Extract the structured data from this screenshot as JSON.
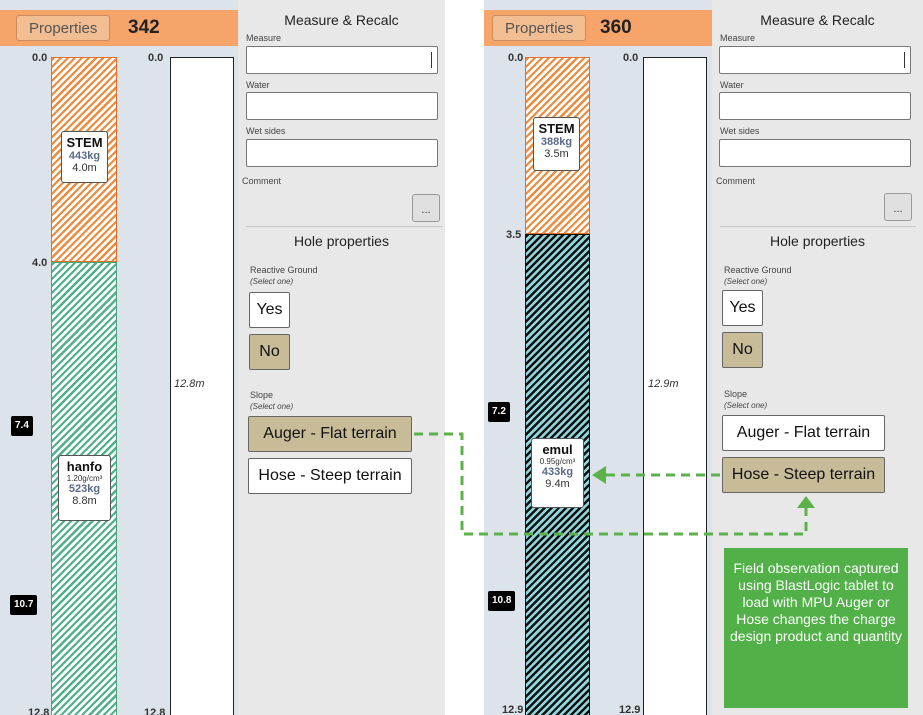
{
  "left": {
    "properties_label": "Properties",
    "hole_number": "342",
    "depth_top": "0.0",
    "depth_top_hole": "0.0",
    "depth_stem_bottom": "4.0",
    "tag_upper": "7.4",
    "tag_lower": "10.7",
    "depth_bottom": "12.8",
    "depth_bottom_hole": "12.8",
    "hole_length": "12.8m",
    "stem": {
      "name": "STEM",
      "kg": "443kg",
      "length": "4.0m"
    },
    "charge": {
      "name": "hanfo",
      "density": "1.20g/cm³",
      "kg": "523kg",
      "length": "8.8m"
    },
    "form": {
      "title": "Measure & Recalc",
      "measure_label": "Measure",
      "water_label": "Water",
      "wet_sides_label": "Wet sides",
      "comment_label": "Comment",
      "dots_label": "...",
      "hole_props_title": "Hole properties",
      "reactive_label": "Reactive Ground",
      "select_one": "(Select one)",
      "yes": "Yes",
      "no": "No",
      "slope_label": "Slope",
      "slope_select_one": "(Select one)",
      "auger": "Auger - Flat terrain",
      "hose": "Hose - Steep terrain"
    }
  },
  "right": {
    "properties_label": "Properties",
    "hole_number": "360",
    "depth_top": "0.0",
    "depth_top_hole": "0.0",
    "depth_stem_bottom": "3.5",
    "tag_upper": "7.2",
    "tag_lower": "10.8",
    "depth_bottom": "12.9",
    "depth_bottom_hole": "12.9",
    "hole_length": "12.9m",
    "stem": {
      "name": "STEM",
      "kg": "388kg",
      "length": "3.5m"
    },
    "charge": {
      "name": "emul",
      "density": "0.95g/cm³",
      "kg": "433kg",
      "length": "9.4m"
    },
    "form": {
      "title": "Measure & Recalc",
      "measure_label": "Measure",
      "water_label": "Water",
      "wet_sides_label": "Wet sides",
      "comment_label": "Comment",
      "dots_label": "...",
      "hole_props_title": "Hole properties",
      "reactive_label": "Reactive Ground",
      "select_one": "(Select one)",
      "yes": "Yes",
      "no": "No",
      "slope_label": "Slope",
      "slope_select_one": "(Select one)",
      "auger": "Auger - Flat terrain",
      "hose": "Hose - Steep terrain"
    }
  },
  "annotation": "Field observation captured using BlastLogic tablet to load with MPU Auger or Hose changes the charge design product and quantity",
  "colors": {
    "properties_bar": "#f7a46a",
    "stem": "#f08a3c",
    "hanfo": "#4fb188",
    "emul": "#8fd6dd",
    "selected_option": "#c7bb98",
    "arrow": "#5bb14a",
    "annotation_bg": "#51b148"
  }
}
